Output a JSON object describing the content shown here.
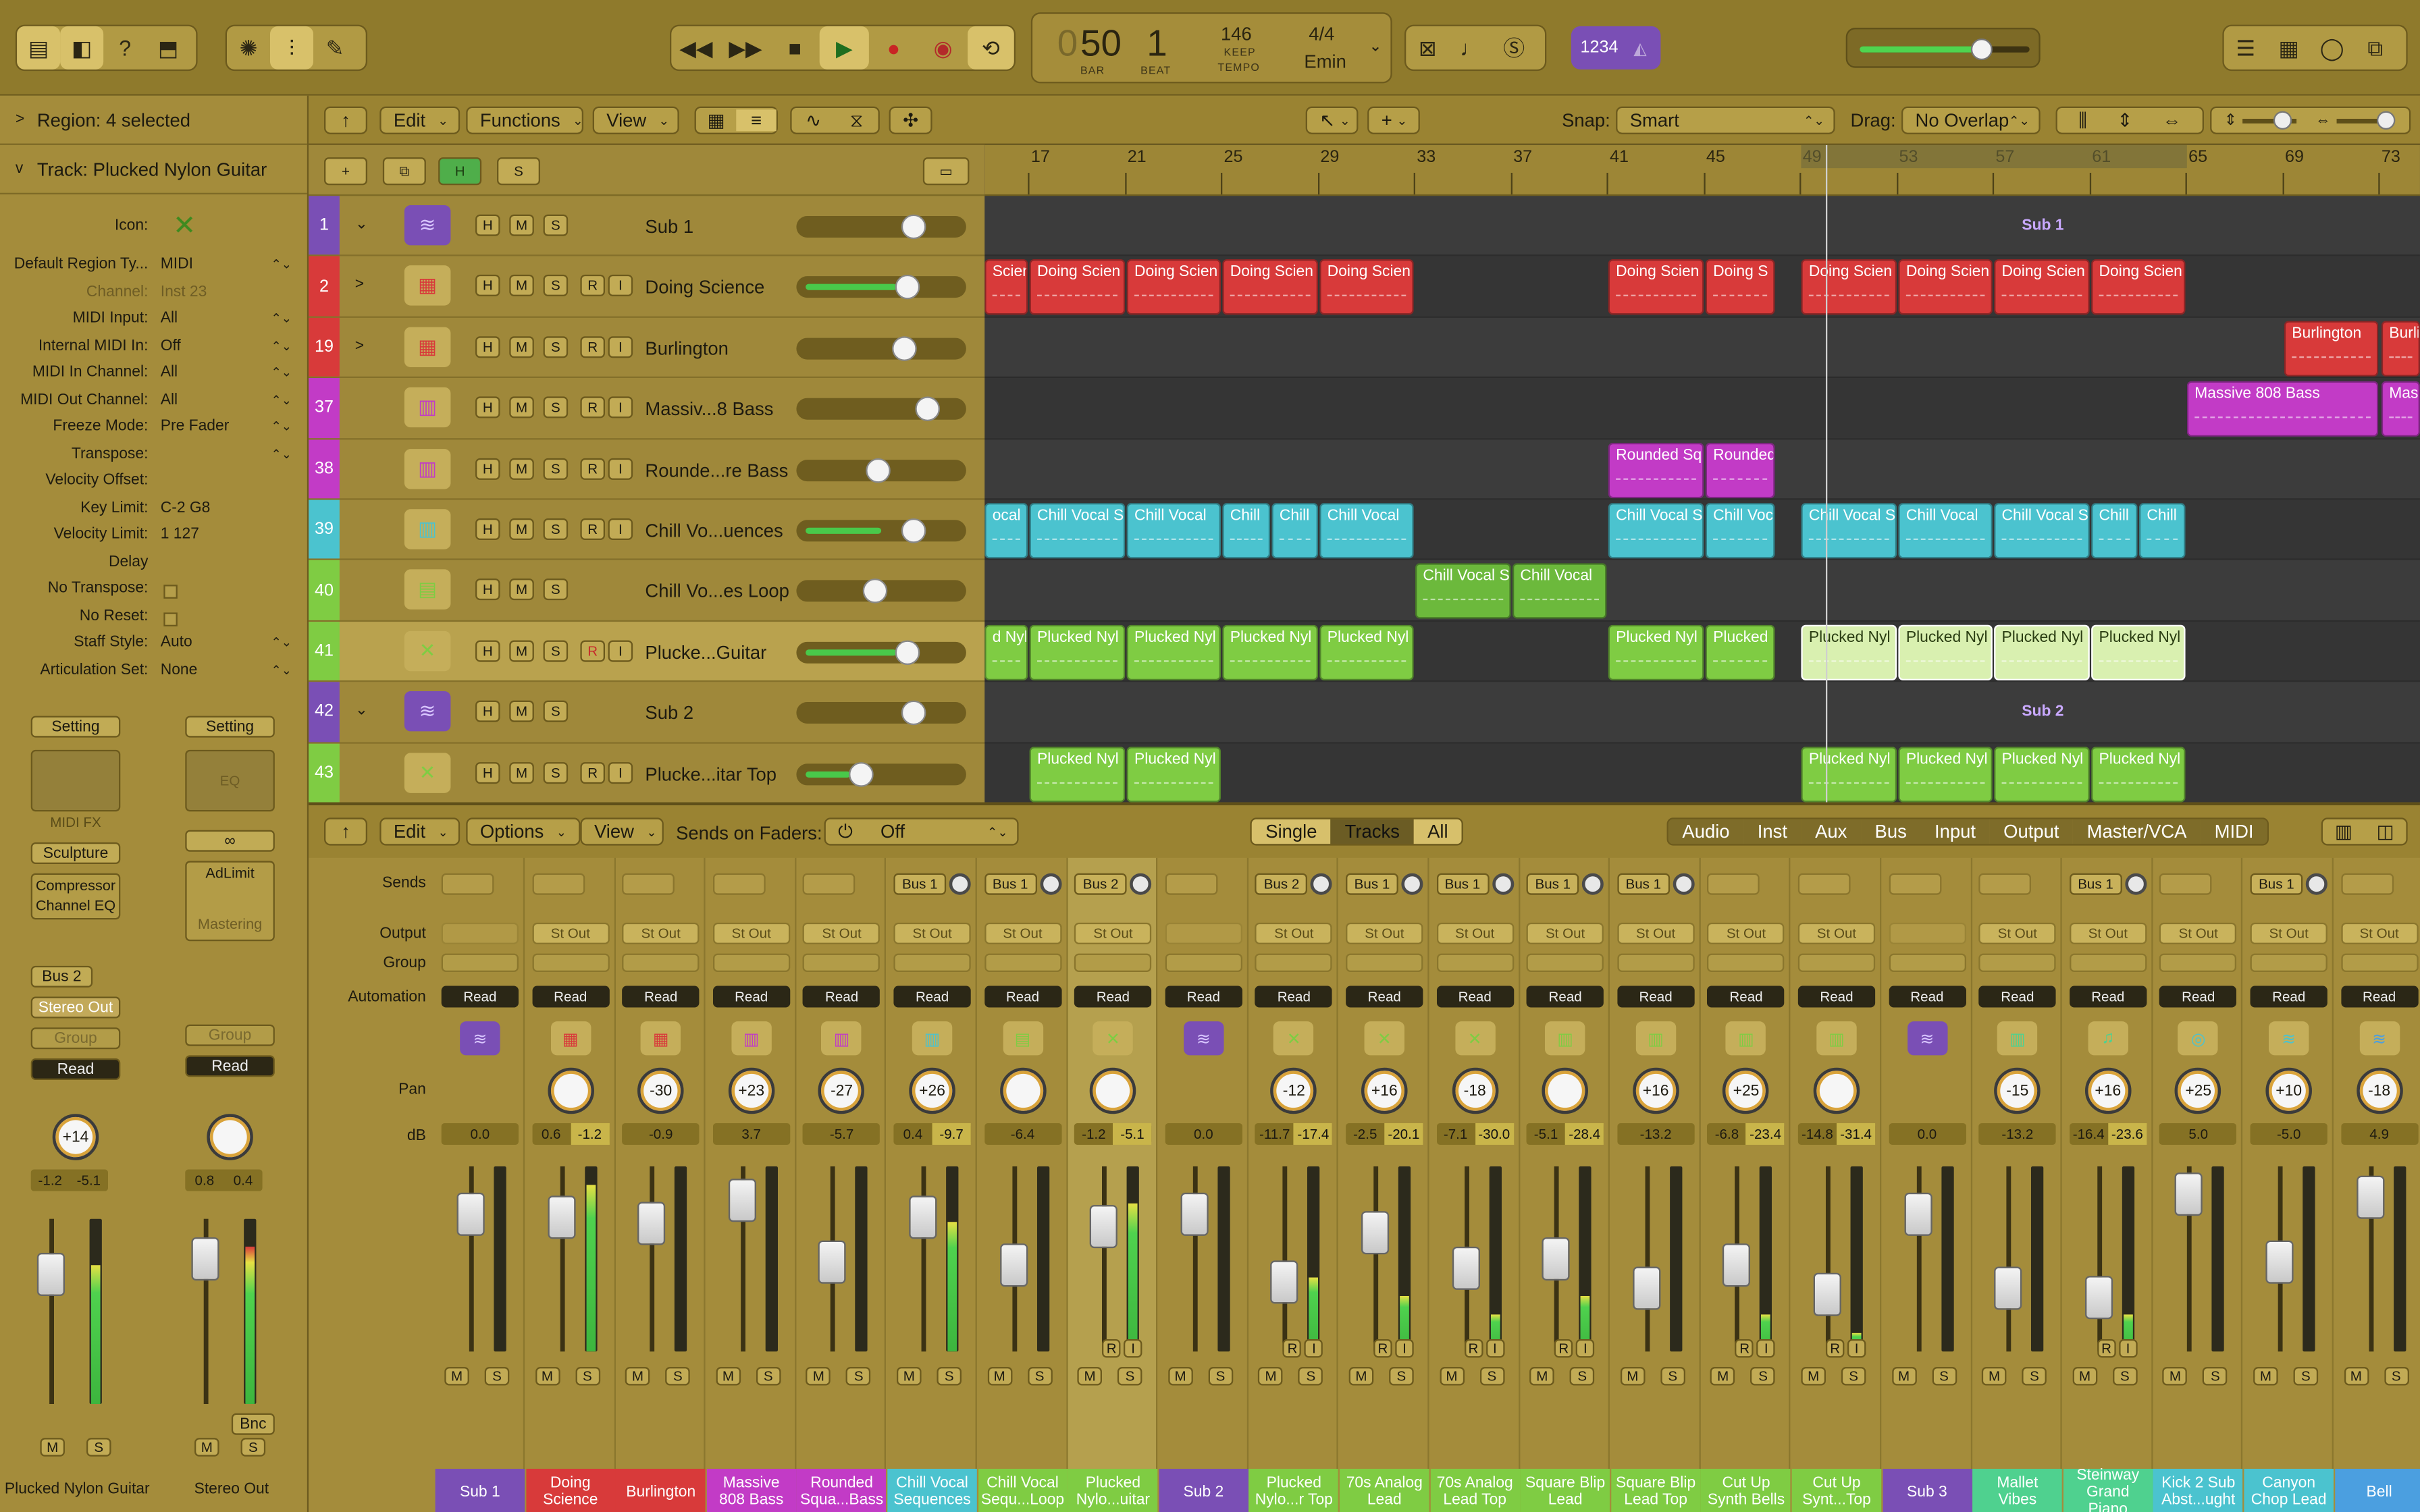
{
  "colors": {
    "accent_gold": "#a38b3a",
    "sub_purple": "#7a4fb5",
    "red": "#d83a3a",
    "magenta": "#c23bc6",
    "cyan": "#4bc3cf",
    "green": "#7fcc43"
  },
  "control_bar": {
    "lcd": {
      "bar_dim": "0",
      "bar": "50",
      "beat": "1",
      "bar_label": "BAR",
      "beat_label": "BEAT",
      "tempo": "146",
      "tempo_mode": "KEEP",
      "tempo_label": "TEMPO",
      "signature": "4/4",
      "key": "Emin"
    },
    "cpu_label": "1234"
  },
  "inspector": {
    "region_header": "Region: 4 selected",
    "track_header": "Track:  Plucked Nylon Guitar",
    "properties": [
      {
        "label": "Icon:",
        "value": ""
      },
      {
        "label": "Default Region Ty...",
        "value": "MIDI"
      },
      {
        "label": "Channel:",
        "value": "Inst 23"
      },
      {
        "label": "MIDI Input:",
        "value": "All"
      },
      {
        "label": "Internal MIDI In:",
        "value": "Off"
      },
      {
        "label": "MIDI In Channel:",
        "value": "All"
      },
      {
        "label": "MIDI Out Channel:",
        "value": "All"
      },
      {
        "label": "Freeze Mode:",
        "value": "Pre Fader"
      },
      {
        "label": "Transpose:",
        "value": ""
      },
      {
        "label": "Velocity Offset:",
        "value": ""
      },
      {
        "label": "Key Limit:",
        "value": "C-2  G8"
      },
      {
        "label": "Velocity Limit:",
        "value": "1  127"
      },
      {
        "label": "Delay",
        "value": ""
      },
      {
        "label": "No Transpose:",
        "value": ""
      },
      {
        "label": "No Reset:",
        "value": ""
      },
      {
        "label": "Staff Style:",
        "value": "Auto"
      },
      {
        "label": "Articulation Set:",
        "value": "None"
      }
    ],
    "strip_left": {
      "setting": "Setting",
      "midi_fx": "MIDI FX",
      "instrument": "Sculpture",
      "plugin1": "Compressor",
      "plugin2": "Channel EQ",
      "send": "Bus 2",
      "output": "Stereo Out",
      "group": "Group",
      "automation": "Read",
      "pan": "+14",
      "db1": "-1.2",
      "db2": "-5.1",
      "mute": "M",
      "solo": "S",
      "name": "Plucked Nylon Guitar"
    },
    "strip_right": {
      "setting": "Setting",
      "eq": "EQ",
      "plugin1": "AdLimit",
      "mastering": "Mastering",
      "group": "Group",
      "automation": "Read",
      "db1": "0.8",
      "db2": "0.4",
      "bounce": "Bnc",
      "mute": "M",
      "solo": "S",
      "name": "Stereo Out"
    }
  },
  "tracks_toolbar": {
    "edit": "Edit",
    "functions": "Functions",
    "view": "View",
    "snap_label": "Snap:",
    "snap_value": "Smart",
    "drag_label": "Drag:",
    "drag_value": "No Overlap"
  },
  "header_tools": {
    "h": "H",
    "s": "S"
  },
  "buttons": {
    "h": "H",
    "m": "M",
    "s": "S",
    "r": "R",
    "i": "I"
  },
  "ruler": [
    "17",
    "21",
    "25",
    "29",
    "33",
    "37",
    "41",
    "45",
    "49",
    "53",
    "57",
    "61",
    "65",
    "69",
    "73"
  ],
  "tracks": [
    {
      "num": "1",
      "name": "Sub 1",
      "color": "#7a4fb5",
      "icon": "waveform-icon",
      "expander": "v",
      "rec": false,
      "vol": 0.72,
      "level": 0
    },
    {
      "num": "2",
      "name": "Doing Science",
      "color": "#d83a3a",
      "icon": "drum-machine-icon",
      "expander": ">",
      "rec": true,
      "vol": 0.68,
      "level": 0.6
    },
    {
      "num": "19",
      "name": "Burlington",
      "color": "#d83a3a",
      "icon": "drum-machine-icon",
      "expander": ">",
      "rec": true,
      "vol": 0.66,
      "level": 0
    },
    {
      "num": "37",
      "name": "Massiv...8 Bass",
      "color": "#c23bc6",
      "icon": "synth-keys-icon",
      "expander": "",
      "rec": true,
      "vol": 0.82,
      "level": 0
    },
    {
      "num": "38",
      "name": "Rounde...re Bass",
      "color": "#c23bc6",
      "icon": "synth-keys-icon",
      "expander": "",
      "rec": true,
      "vol": 0.48,
      "level": 0
    },
    {
      "num": "39",
      "name": "Chill Vo...uences",
      "color": "#4bc3cf",
      "icon": "synth-keys-icon",
      "expander": "",
      "rec": true,
      "vol": 0.72,
      "level": 0.5
    },
    {
      "num": "40",
      "name": "Chill Vo...es Loop",
      "color": "#7fcc43",
      "icon": "drum-keys-icon",
      "expander": "",
      "rec": false,
      "vol": 0.46,
      "level": 0
    },
    {
      "num": "41",
      "name": "Plucke...Guitar",
      "color": "#7fcc43",
      "icon": "guitar-icon",
      "expander": "",
      "rec": true,
      "vol": 0.68,
      "level": 0.6
    },
    {
      "num": "42",
      "name": "Sub 2",
      "color": "#7a4fb5",
      "icon": "waveform-icon",
      "expander": "v",
      "rec": false,
      "vol": 0.72,
      "level": 0
    },
    {
      "num": "43",
      "name": "Plucke...itar Top",
      "color": "#7fcc43",
      "icon": "guitar-icon",
      "expander": "",
      "rec": true,
      "vol": 0.36,
      "level": 0.3
    }
  ],
  "summary_labels": {
    "sub1": "Sub 1",
    "sub2": "Sub 2"
  },
  "regions": [
    {
      "lane": 1,
      "start": 0,
      "end": 28,
      "label": "Scien",
      "color": "#d83a3a"
    },
    {
      "lane": 1,
      "start": 29,
      "end": 91,
      "label": "Doing Scien",
      "color": "#d83a3a"
    },
    {
      "lane": 1,
      "start": 92,
      "end": 153,
      "label": "Doing Scien",
      "color": "#d83a3a"
    },
    {
      "lane": 1,
      "start": 154,
      "end": 216,
      "label": "Doing Scien",
      "color": "#d83a3a"
    },
    {
      "lane": 1,
      "start": 217,
      "end": 278,
      "label": "Doing Scien",
      "color": "#d83a3a"
    },
    {
      "lane": 1,
      "start": 404,
      "end": 466,
      "label": "Doing Scien",
      "color": "#d83a3a"
    },
    {
      "lane": 1,
      "start": 467,
      "end": 512,
      "label": "Doing S",
      "color": "#d83a3a"
    },
    {
      "lane": 1,
      "start": 529,
      "end": 591,
      "label": "Doing Scien",
      "color": "#d83a3a"
    },
    {
      "lane": 1,
      "start": 592,
      "end": 653,
      "label": "Doing Scien",
      "color": "#d83a3a"
    },
    {
      "lane": 1,
      "start": 654,
      "end": 716,
      "label": "Doing Scien",
      "color": "#d83a3a"
    },
    {
      "lane": 1,
      "start": 717,
      "end": 778,
      "label": "Doing Scien",
      "color": "#d83a3a"
    },
    {
      "lane": 2,
      "start": 842,
      "end": 903,
      "label": "Burlington",
      "color": "#d83a3a"
    },
    {
      "lane": 2,
      "start": 905,
      "end": 930,
      "label": "Burli",
      "color": "#d83a3a"
    },
    {
      "lane": 3,
      "start": 779,
      "end": 903,
      "label": "Massive 808 Bass",
      "color": "#c23bc6"
    },
    {
      "lane": 3,
      "start": 905,
      "end": 930,
      "label": "Mass",
      "color": "#c23bc6"
    },
    {
      "lane": 4,
      "start": 404,
      "end": 466,
      "label": "Rounded Sq",
      "color": "#c23bc6"
    },
    {
      "lane": 4,
      "start": 467,
      "end": 512,
      "label": "Rounded",
      "color": "#c23bc6"
    },
    {
      "lane": 5,
      "start": 0,
      "end": 28,
      "label": "ocal",
      "color": "#4bc3cf"
    },
    {
      "lane": 5,
      "start": 29,
      "end": 91,
      "label": "Chill Vocal S",
      "color": "#4bc3cf"
    },
    {
      "lane": 5,
      "start": 92,
      "end": 153,
      "label": "Chill Vocal",
      "color": "#4bc3cf"
    },
    {
      "lane": 5,
      "start": 154,
      "end": 185,
      "label": "Chill",
      "color": "#4bc3cf"
    },
    {
      "lane": 5,
      "start": 186,
      "end": 216,
      "label": "Chill",
      "color": "#4bc3cf"
    },
    {
      "lane": 5,
      "start": 217,
      "end": 278,
      "label": "Chill Vocal",
      "color": "#4bc3cf"
    },
    {
      "lane": 5,
      "start": 404,
      "end": 466,
      "label": "Chill Vocal S",
      "color": "#4bc3cf"
    },
    {
      "lane": 5,
      "start": 467,
      "end": 512,
      "label": "Chill Voc",
      "color": "#4bc3cf"
    },
    {
      "lane": 5,
      "start": 529,
      "end": 591,
      "label": "Chill Vocal S",
      "color": "#4bc3cf"
    },
    {
      "lane": 5,
      "start": 592,
      "end": 653,
      "label": "Chill Vocal",
      "color": "#4bc3cf"
    },
    {
      "lane": 5,
      "start": 654,
      "end": 716,
      "label": "Chill Vocal S",
      "color": "#4bc3cf"
    },
    {
      "lane": 5,
      "start": 717,
      "end": 747,
      "label": "Chill",
      "color": "#4bc3cf"
    },
    {
      "lane": 5,
      "start": 748,
      "end": 778,
      "label": "Chill",
      "color": "#4bc3cf"
    },
    {
      "lane": 6,
      "start": 279,
      "end": 341,
      "label": "Chill Vocal S",
      "color": "#6cb93c"
    },
    {
      "lane": 6,
      "start": 342,
      "end": 403,
      "label": "Chill Vocal",
      "color": "#6cb93c"
    },
    {
      "lane": 7,
      "start": 0,
      "end": 28,
      "label": "d Nyl",
      "color": "#7fcc43"
    },
    {
      "lane": 7,
      "start": 29,
      "end": 91,
      "label": "Plucked Nyl",
      "color": "#7fcc43"
    },
    {
      "lane": 7,
      "start": 92,
      "end": 153,
      "label": "Plucked Nyl",
      "color": "#7fcc43"
    },
    {
      "lane": 7,
      "start": 154,
      "end": 216,
      "label": "Plucked Nyl",
      "color": "#7fcc43"
    },
    {
      "lane": 7,
      "start": 217,
      "end": 278,
      "label": "Plucked Nyl",
      "color": "#7fcc43"
    },
    {
      "lane": 7,
      "start": 404,
      "end": 466,
      "label": "Plucked Nyl",
      "color": "#7fcc43"
    },
    {
      "lane": 7,
      "start": 467,
      "end": 512,
      "label": "Plucked",
      "color": "#7fcc43"
    },
    {
      "lane": 7,
      "start": 529,
      "end": 591,
      "label": "Plucked Nyl",
      "color": "#d9f0b0",
      "selected": true
    },
    {
      "lane": 7,
      "start": 592,
      "end": 653,
      "label": "Plucked Nyl",
      "color": "#d9f0b0",
      "selected": true
    },
    {
      "lane": 7,
      "start": 654,
      "end": 716,
      "label": "Plucked Nyl",
      "color": "#d9f0b0",
      "selected": true
    },
    {
      "lane": 7,
      "start": 717,
      "end": 778,
      "label": "Plucked Nyl",
      "color": "#d9f0b0",
      "selected": true
    },
    {
      "lane": 9,
      "start": 29,
      "end": 91,
      "label": "Plucked Nyl",
      "color": "#7fcc43"
    },
    {
      "lane": 9,
      "start": 92,
      "end": 153,
      "label": "Plucked Nyl",
      "color": "#7fcc43"
    },
    {
      "lane": 9,
      "start": 529,
      "end": 591,
      "label": "Plucked Nyl",
      "color": "#7fcc43"
    },
    {
      "lane": 9,
      "start": 592,
      "end": 653,
      "label": "Plucked Nyl",
      "color": "#7fcc43"
    },
    {
      "lane": 9,
      "start": 654,
      "end": 716,
      "label": "Plucked Nyl",
      "color": "#7fcc43"
    },
    {
      "lane": 9,
      "start": 717,
      "end": 778,
      "label": "Plucked Nyl",
      "color": "#7fcc43"
    }
  ],
  "mixer_toolbar": {
    "edit": "Edit",
    "options": "Options",
    "view": "View",
    "sends_on_faders": "Sends on Faders:",
    "sends_value": "Off",
    "scope": [
      "Single",
      "Tracks",
      "All"
    ],
    "filters": [
      "Audio",
      "Inst",
      "Aux",
      "Bus",
      "Input",
      "Output",
      "Master/VCA",
      "MIDI"
    ]
  },
  "mixer_labels": {
    "sends": "Sends",
    "output": "Output",
    "group": "Group",
    "automation": "Automation",
    "pan": "Pan",
    "db": "dB"
  },
  "strip_common": {
    "output": "St Out",
    "automation": "Read",
    "mute": "M",
    "solo": "S",
    "rec": "R",
    "input": "I"
  },
  "strips": [
    {
      "name": "Sub 1",
      "color": "#7a4fb5",
      "send": "",
      "output": false,
      "pan": "",
      "db": "0.0",
      "peak": "",
      "level": 0,
      "fader": 0.82,
      "icon": "waveform-icon"
    },
    {
      "name": "Doing Science",
      "color": "#d83a3a",
      "send": "",
      "output": true,
      "pan": "",
      "db": "0.6",
      "peak": "-1.2",
      "level": 0.9,
      "fader": 0.8,
      "icon": "drum-machine-icon"
    },
    {
      "name": "Burlington",
      "color": "#d83a3a",
      "send": "",
      "output": true,
      "pan": "-30",
      "db": "-0.9",
      "peak": "",
      "level": 0,
      "fader": 0.76,
      "icon": "drum-machine-icon"
    },
    {
      "name": "Massive 808 Bass",
      "color": "#c23bc6",
      "send": "",
      "output": true,
      "pan": "+23",
      "db": "3.7",
      "peak": "",
      "level": 0,
      "fader": 0.92,
      "icon": "synth-keys-icon"
    },
    {
      "name": "Rounded Squa...Bass",
      "color": "#c23bc6",
      "send": "",
      "output": true,
      "pan": "-27",
      "db": "-5.7",
      "peak": "",
      "level": 0,
      "fader": 0.5,
      "icon": "synth-keys-icon"
    },
    {
      "name": "Chill Vocal Sequences",
      "color": "#4bc3cf",
      "send": "Bus 1",
      "output": true,
      "pan": "+26",
      "db": "0.4",
      "peak": "-9.7",
      "level": 0.7,
      "fader": 0.8,
      "icon": "synth-keys-icon"
    },
    {
      "name": "Chill Vocal Sequ...Loop",
      "color": "#7fcc43",
      "send": "Bus 1",
      "output": true,
      "pan": "",
      "db": "-6.4",
      "peak": "",
      "level": 0,
      "fader": 0.48,
      "icon": "drum-keys-icon"
    },
    {
      "name": "Plucked Nylo...uitar",
      "color": "#7fcc43",
      "send": "Bus 2",
      "output": true,
      "pan": "",
      "db": "-1.2",
      "peak": "-5.1",
      "level": 0.8,
      "fader": 0.74,
      "icon": "guitar-icon",
      "selected": true
    },
    {
      "name": "Sub 2",
      "color": "#7a4fb5",
      "send": "",
      "output": false,
      "pan": "",
      "db": "0.0",
      "peak": "",
      "level": 0,
      "fader": 0.82,
      "icon": "waveform-icon"
    },
    {
      "name": "Plucked Nylo...r Top",
      "color": "#7fcc43",
      "send": "Bus 2",
      "output": true,
      "pan": "-12",
      "db": "-11.7",
      "peak": "-17.4",
      "level": 0.4,
      "fader": 0.36,
      "icon": "guitar-icon"
    },
    {
      "name": "70s Analog Lead",
      "color": "#7fcc43",
      "send": "Bus 1",
      "output": true,
      "pan": "+16",
      "db": "-2.5",
      "peak": "-20.1",
      "level": 0.3,
      "fader": 0.7,
      "icon": "guitar-icon"
    },
    {
      "name": "70s Analog Lead Top",
      "color": "#7fcc43",
      "send": "Bus 1",
      "output": true,
      "pan": "-18",
      "db": "-7.1",
      "peak": "-30.0",
      "level": 0.2,
      "fader": 0.46,
      "icon": "guitar-icon"
    },
    {
      "name": "Square Blip Lead",
      "color": "#7fcc43",
      "send": "Bus 1",
      "output": true,
      "pan": "",
      "db": "-5.1",
      "peak": "-28.4",
      "level": 0.3,
      "fader": 0.52,
      "icon": "synth-keys-icon"
    },
    {
      "name": "Square Blip Lead Top",
      "color": "#7fcc43",
      "send": "Bus 1",
      "output": true,
      "pan": "+16",
      "db": "-13.2",
      "peak": "",
      "level": 0,
      "fader": 0.32,
      "icon": "synth-keys-icon"
    },
    {
      "name": "Cut Up Synth Bells",
      "color": "#7fcc43",
      "send": "",
      "output": true,
      "pan": "+25",
      "db": "-6.8",
      "peak": "-23.4",
      "level": 0.2,
      "fader": 0.48,
      "icon": "synth-keys-icon"
    },
    {
      "name": "Cut Up Synt...Top",
      "color": "#7fcc43",
      "send": "",
      "output": true,
      "pan": "",
      "db": "-14.8",
      "peak": "-31.4",
      "level": 0.1,
      "fader": 0.28,
      "icon": "synth-keys-icon"
    },
    {
      "name": "Sub 3",
      "color": "#7a4fb5",
      "send": "",
      "output": false,
      "pan": "",
      "db": "0.0",
      "peak": "",
      "level": 0,
      "fader": 0.82,
      "icon": "waveform-icon"
    },
    {
      "name": "Mallet Vibes",
      "color": "#4fd18f",
      "send": "",
      "output": true,
      "pan": "-15",
      "db": "-13.2",
      "peak": "",
      "level": 0,
      "fader": 0.32,
      "icon": "synth-keys-icon"
    },
    {
      "name": "Steinway Grand Piano",
      "color": "#4fd18f",
      "send": "Bus 1",
      "output": true,
      "pan": "+16",
      "db": "-16.4",
      "peak": "-23.6",
      "level": 0.2,
      "fader": 0.26,
      "icon": "piano-icon"
    },
    {
      "name": "Kick 2 Sub Abst...ught",
      "color": "#4bc3cf",
      "send": "",
      "output": true,
      "pan": "+25",
      "db": "5.0",
      "peak": "",
      "level": 0,
      "fader": 0.96,
      "icon": "speaker-icon"
    },
    {
      "name": "Canyon Chop Lead",
      "color": "#4bc3cf",
      "send": "Bus 1",
      "output": true,
      "pan": "+10",
      "db": "-5.0",
      "peak": "",
      "level": 0,
      "fader": 0.5,
      "icon": "waveform-icon"
    },
    {
      "name": "Bell",
      "color": "#4b9fe0",
      "send": "",
      "output": true,
      "pan": "-18",
      "db": "4.9",
      "peak": "",
      "level": 0,
      "fader": 0.94,
      "icon": "waveform-icon"
    }
  ]
}
